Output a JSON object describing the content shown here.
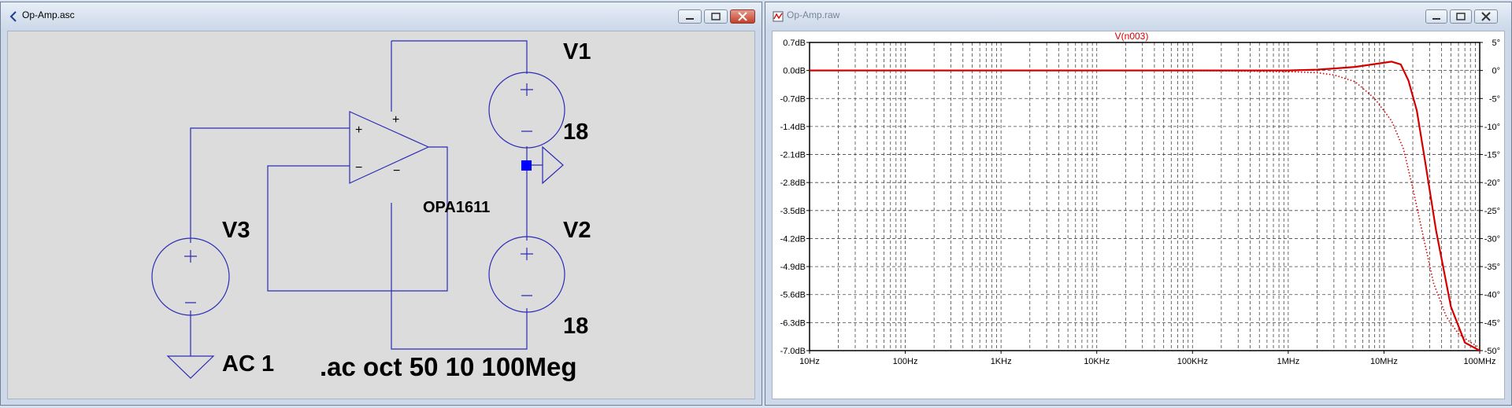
{
  "schematic_window": {
    "title": "Op-Amp.asc",
    "labels": {
      "v1": "V1",
      "v1_value": "18",
      "v2": "V2",
      "v2_value": "18",
      "v3": "V3",
      "v3_value": "AC 1",
      "opamp": "OPA1611",
      "directive": ".ac oct 50 10 100Meg",
      "plus": "+",
      "minus": "−"
    }
  },
  "plot_window": {
    "title": "Op-Amp.raw",
    "trace_label": "V(n003)",
    "trace_color": "#d40000",
    "grid_color": "#444444",
    "left_axis_ticks": [
      "0.7dB",
      "0.0dB",
      "-0.7dB",
      "-1.4dB",
      "-2.1dB",
      "-2.8dB",
      "-3.5dB",
      "-4.2dB",
      "-4.9dB",
      "-5.6dB",
      "-6.3dB",
      "-7.0dB"
    ],
    "right_axis_ticks": [
      "5°",
      "0°",
      "-5°",
      "-10°",
      "-15°",
      "-20°",
      "-25°",
      "-30°",
      "-35°",
      "-40°",
      "-45°",
      "-50°"
    ],
    "x_axis_ticks": [
      "10Hz",
      "100Hz",
      "1KHz",
      "10KHz",
      "100KHz",
      "1MHz",
      "10MHz",
      "100MHz"
    ]
  },
  "chart_data": {
    "type": "line",
    "title": "V(n003)",
    "x_scale": "log",
    "xlim": [
      10,
      100000000
    ],
    "ylim": [
      -7.0,
      0.7
    ],
    "y2lim": [
      -50,
      5
    ],
    "series": [
      {
        "name": "V(n003)",
        "style": "solid",
        "axis": "magnitude_dB",
        "x": [
          10,
          100,
          1000,
          10000,
          100000,
          1000000,
          2000000,
          3000000,
          5000000,
          8000000,
          12000000,
          15000000,
          18000000,
          22000000,
          27000000,
          35000000,
          50000000,
          70000000,
          100000000
        ],
        "values": [
          0,
          0,
          0,
          0,
          0,
          0,
          0.02,
          0.05,
          0.09,
          0.16,
          0.22,
          0.15,
          -0.25,
          -1.0,
          -2.3,
          -4.0,
          -5.9,
          -6.8,
          -7.0
        ]
      },
      {
        "name": "V(n003)",
        "style": "dotted",
        "axis": "phase_deg",
        "x": [
          10,
          100,
          1000,
          10000,
          100000,
          1000000,
          2000000,
          3000000,
          5000000,
          8000000,
          12000000,
          16000000,
          20000000,
          26000000,
          33000000,
          45000000,
          60000000,
          80000000,
          100000000
        ],
        "values": [
          0,
          0,
          0,
          0,
          -0.02,
          -0.2,
          -0.4,
          -0.8,
          -2,
          -5,
          -9,
          -14,
          -21,
          -30,
          -38,
          -44,
          -47,
          -48.5,
          -49.5
        ]
      }
    ]
  }
}
